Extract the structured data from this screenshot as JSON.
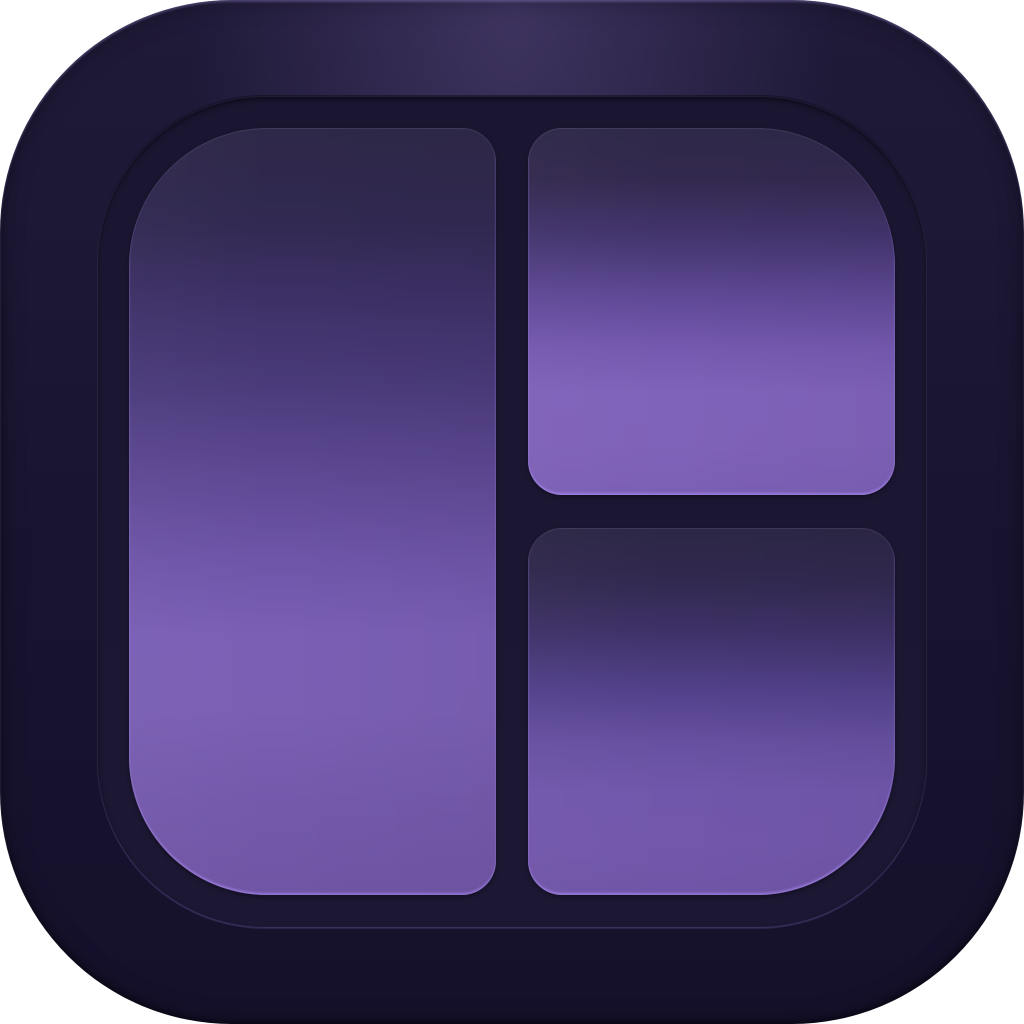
{
  "app_icon": {
    "name": "layout-grid-icon",
    "colors": {
      "frame": "#181430",
      "tray": "#1b1632",
      "panel_top": "#2e2848",
      "panel_mid": "#7a5fb5",
      "panel_edge_glow": "#b496ff"
    },
    "panels": [
      {
        "name": "left-panel"
      },
      {
        "name": "top-right-panel"
      },
      {
        "name": "bottom-right-panel"
      }
    ]
  }
}
